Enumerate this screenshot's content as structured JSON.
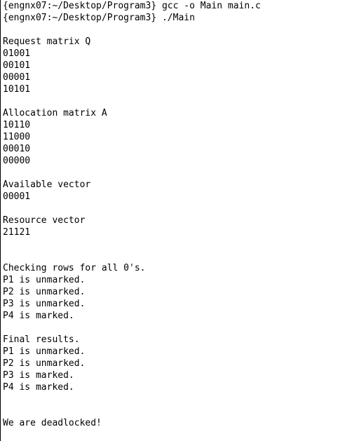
{
  "terminal": {
    "lines": [
      "{engnx07:~/Desktop/Program3} gcc -o Main main.c",
      "{engnx07:~/Desktop/Program3} ./Main",
      "",
      "Request matrix Q",
      "01001",
      "00101",
      "00001",
      "10101",
      "",
      "Allocation matrix A",
      "10110",
      "11000",
      "00010",
      "00000",
      "",
      "Available vector",
      "00001",
      "",
      "Resource vector",
      "21121",
      "",
      "",
      "Checking rows for all 0's.",
      "P1 is unmarked.",
      "P2 is unmarked.",
      "P3 is unmarked.",
      "P4 is marked.",
      "",
      "Final results.",
      "P1 is unmarked.",
      "P2 is unmarked.",
      "P3 is marked.",
      "P4 is marked.",
      "",
      "",
      "We are deadlocked!"
    ]
  }
}
